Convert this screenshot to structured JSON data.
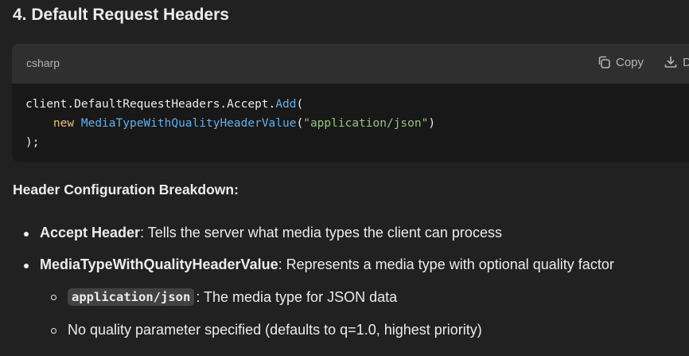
{
  "heading": "4. Default Request Headers",
  "code_block": {
    "language": "csharp",
    "copy_label": "Copy",
    "download_label": "D",
    "line1_obj": "client.DefaultRequestHeaders.Accept.",
    "line1_method": "Add",
    "line1_paren": "(",
    "line2_kw": "new",
    "line2_type": "MediaTypeWithQualityHeaderValue",
    "line2_open": "(",
    "line2_string": "\"application/json\"",
    "line2_close": ")",
    "line3": ");"
  },
  "subheading": "Header Configuration Breakdown:",
  "list": [
    {
      "term": "Accept Header",
      "text": ": Tells the server what media types the client can process"
    },
    {
      "term": "MediaTypeWithQualityHeaderValue",
      "text": ": Represents a media type with optional quality factor"
    }
  ],
  "sublist": [
    {
      "code": "application/json",
      "text": ": The media type for JSON data"
    },
    {
      "text": "No quality parameter specified (defaults to q=1.0, highest priority)"
    }
  ]
}
